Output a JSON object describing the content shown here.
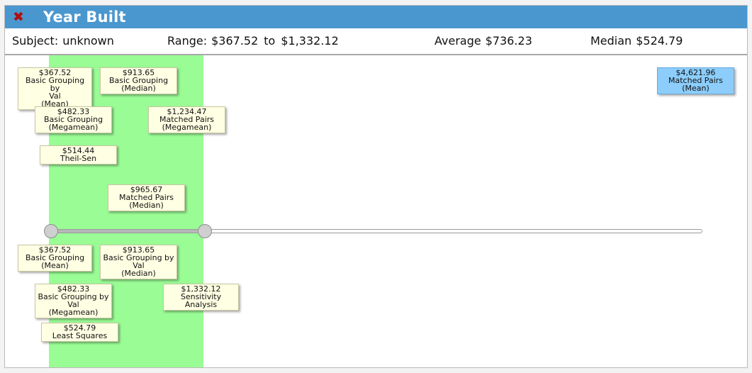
{
  "title_bar": {
    "close_glyph": "✖",
    "title": "Year Built",
    "colors": {
      "bar": "#4a97cf",
      "close": "#b20d0d"
    }
  },
  "info_bar": {
    "subject_label": "Subject:",
    "subject_value": "unknown",
    "range_label": "Range:",
    "range_low": "$367.52",
    "range_to": "to",
    "range_high": "$1,332.12",
    "average_label": "Average",
    "average_value": "$736.23",
    "median_label": "Median",
    "median_value": "$524.79"
  },
  "colors": {
    "selected_band": "#9afc95",
    "label_bg": "#ffffe3",
    "outlier_bg": "#8ccdfb"
  },
  "slider": {
    "low": "$367.52",
    "high": "$1,332.12"
  },
  "labels_above": [
    {
      "value": "$367.52",
      "line1": "Basic Grouping by",
      "line2": "Val",
      "line3": "(Mean)"
    },
    {
      "value": "$913.65",
      "line1": "Basic Grouping",
      "line2": "(Median)"
    },
    {
      "value": "$482.33",
      "line1": "Basic Grouping",
      "line2": "(Megamean)"
    },
    {
      "value": "$1,234.47",
      "line1": "Matched Pairs",
      "line2": "(Megamean)"
    },
    {
      "value": "$514.44",
      "line1": "Theil-Sen"
    },
    {
      "value": "$965.67",
      "line1": "Matched Pairs",
      "line2": "(Median)"
    },
    {
      "value": "$4,621.96",
      "line1": "Matched Pairs",
      "line2": "(Mean)",
      "outlier": true
    }
  ],
  "labels_below": [
    {
      "value": "$367.52",
      "line1": "Basic Grouping",
      "line2": "(Mean)"
    },
    {
      "value": "$913.65",
      "line1": "Basic Grouping by",
      "line2": "Val",
      "line3": "(Median)"
    },
    {
      "value": "$482.33",
      "line1": "Basic Grouping by",
      "line2": "Val",
      "line3": "(Megamean)"
    },
    {
      "value": "$1,332.12",
      "line1": "Sensitivity Analysis"
    },
    {
      "value": "$524.79",
      "line1": "Least Squares"
    }
  ]
}
